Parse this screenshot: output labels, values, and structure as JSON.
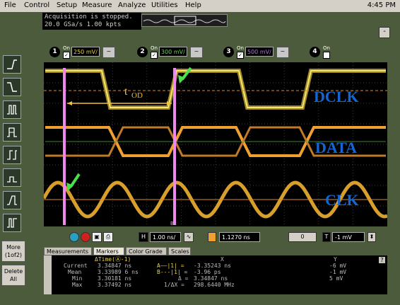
{
  "menu": {
    "items": [
      "File",
      "Control",
      "Setup",
      "Measure",
      "Analyze",
      "Utilities",
      "Help"
    ],
    "clock": "4:45 PM"
  },
  "status": {
    "line1": "Acquisition is stopped.",
    "line2": "20.0 GSa/s   1.00 kpts"
  },
  "window": {
    "minimize_label": "-"
  },
  "channels": [
    {
      "num": "1",
      "on_label": "On",
      "checked": true,
      "scale": "250 mV/",
      "color": "#e8d24a"
    },
    {
      "num": "2",
      "on_label": "On",
      "checked": true,
      "scale": "300 mV/",
      "color": "#6bd35a"
    },
    {
      "num": "3",
      "on_label": "On",
      "checked": true,
      "scale": "500 mV/",
      "color": "#b07ad6"
    },
    {
      "num": "4",
      "on_label": "On",
      "checked": false,
      "scale": "",
      "color": "#ff6666"
    }
  ],
  "left_toolbar": {
    "tools": [
      "rising-edge-trigger-icon",
      "falling-edge-trigger-icon",
      "glitch-trigger-icon",
      "pulse-width-trigger-icon",
      "setup-hold-trigger-icon",
      "runt-trigger-icon",
      "transition-trigger-icon",
      "pattern-trigger-icon"
    ],
    "more_label": "More",
    "more_sub": "(1of2)",
    "delete_label": "Delete",
    "delete_sub": "All"
  },
  "plot": {
    "signals": [
      "DCLK",
      "DATA",
      "CLK"
    ],
    "annotation": "t",
    "annotation_sub": "OD",
    "marker_x_label": "Bx",
    "colors": {
      "dclk": "#f2e86a",
      "data": "#f0a030",
      "clk": "#f0b030",
      "marker": "#ee88ee",
      "accent_label": "#1466d4",
      "arrow": "#4ae04a",
      "ref_line": "#e08a2a"
    }
  },
  "controls": {
    "time_scale": "1.00 ns/",
    "delay": "1.1270 ns",
    "zero": "0",
    "trigger_level": "-1 mV"
  },
  "tabs": [
    "Measurements",
    "Markers",
    "Color Grade",
    "Scales"
  ],
  "active_tab": "Markers",
  "markers": {
    "header_dt": "ΔTime(Ⓐ-1)",
    "header_x": "X",
    "header_y": "Y",
    "rows": [
      {
        "label": "Current",
        "value": "3.34847 ns"
      },
      {
        "label": "Mean",
        "value": "3.33989 6 ns"
      },
      {
        "label": "Min",
        "value": "3.30181 ns"
      },
      {
        "label": "Max",
        "value": "3.37492 ns"
      }
    ],
    "ax_label": "A——|1| =",
    "ax_value": "-3.35243 ns",
    "ay_value": "-6 mV",
    "bx_label": "B---|1| =",
    "bx_value": "-3.96 ps",
    "by_value": "-1 mV",
    "dx_label": "Δ =",
    "dx_value": "3.34847 ns",
    "dy_value": "5 mV",
    "inv_label": "1/ΔX =",
    "inv_value": "298.6440 MHz",
    "help_label": "?"
  }
}
